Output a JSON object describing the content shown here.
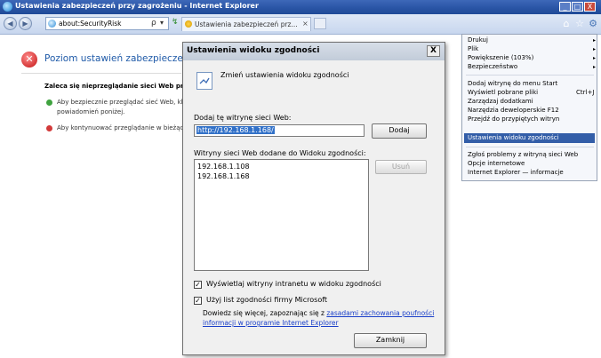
{
  "window": {
    "title": "Ustawienia zabezpieczeń przy zagrożeniu - Internet Explorer",
    "minimize": "_",
    "maximize": "□",
    "close": "X"
  },
  "toolbar": {
    "address": "about:SecurityRisk",
    "search_glyph": "ρ",
    "dropdown_glyph": "▾",
    "refresh_glyph": "↯",
    "tab_title": "Ustawienia zabezpieczeń prz...",
    "tab_close": "×",
    "home_icon": "home-icon",
    "favorites_icon": "star-icon",
    "tools_icon": "gear-icon"
  },
  "page": {
    "title": "Poziom ustawień zabezpieczeń powod",
    "bold_text": "Zaleca się nieprzeglądanie sieci Web przy bi",
    "bullets": [
      {
        "line1": "Aby bezpiecznie przeglądać sieć Web, klik",
        "line2": "powiadomień poniżej.",
        "color": "#3fa33f"
      },
      {
        "line1": "Aby kontynuować przeglądanie w bieżącym",
        "line2": "",
        "color": "#d23a3a"
      }
    ]
  },
  "dialog": {
    "title": "Ustawienia widoku zgodności",
    "close": "X",
    "heading": "Zmień ustawienia widoku zgodności",
    "add_label": "Dodaj tę witrynę sieci Web:",
    "add_value": "http://192.168.1.168/",
    "add_button": "Dodaj",
    "list_label": "Witryny sieci Web dodane do Widoku zgodności:",
    "sites": [
      "192.168.1.108",
      "192.168.1.168"
    ],
    "remove_button": "Usuń",
    "checkbox_intranet": {
      "label": "Wyświetlaj witryny intranetu w widoku zgodności",
      "checked": true,
      "mark": "✓"
    },
    "checkbox_ms_list": {
      "label": "Użyj list zgodności firmy Microsoft",
      "checked": true,
      "mark": "✓"
    },
    "info_prefix": "Dowiedz się więcej, zapoznając się z ",
    "info_link1": "zasadami zachowania poufności",
    "info_link2": "informacji w programie Internet Explorer",
    "close_button": "Zamknij"
  },
  "menu": {
    "items": [
      {
        "label": "Drukuj",
        "arrow": "▸",
        "shortcut": ""
      },
      {
        "label": "Plik",
        "arrow": "▸",
        "shortcut": ""
      },
      {
        "label": "Powiększenie (103%)",
        "arrow": "▸",
        "shortcut": ""
      },
      {
        "label": "Bezpieczeństwo",
        "arrow": "▸",
        "shortcut": ""
      },
      {
        "label": "Dodaj witrynę do menu Start",
        "arrow": "",
        "shortcut": ""
      },
      {
        "label": "Wyświetl pobrane pliki",
        "arrow": "",
        "shortcut": "Ctrl+J"
      },
      {
        "label": "Zarządzaj dodatkami",
        "arrow": "",
        "shortcut": ""
      },
      {
        "label": "Narzędzia deweloperskie F12",
        "arrow": "",
        "shortcut": ""
      },
      {
        "label": "Przejdź do przypiętych witryn",
        "arrow": "",
        "shortcut": ""
      },
      {
        "label": "Ustawienia widoku zgodności",
        "arrow": "",
        "shortcut": ""
      },
      {
        "label": "Zgłoś problemy z witryną sieci Web",
        "arrow": "",
        "shortcut": ""
      },
      {
        "label": "Opcje internetowe",
        "arrow": "",
        "shortcut": ""
      },
      {
        "label": "Internet Explorer — informacje",
        "arrow": "",
        "shortcut": ""
      }
    ]
  },
  "colors": {
    "titlebar": "#2a55a6",
    "link": "#1a3fc9",
    "menu_highlight": "#335ea8"
  }
}
